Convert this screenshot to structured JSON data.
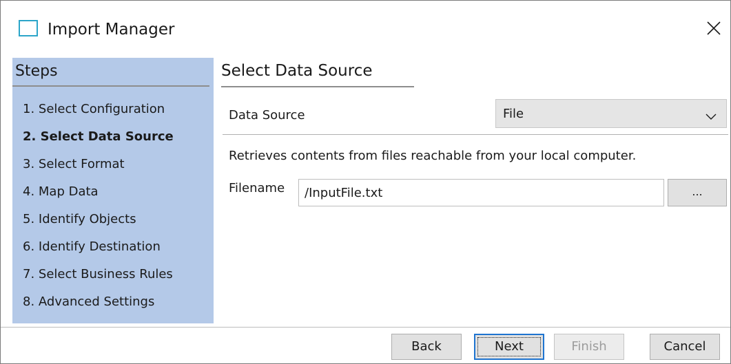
{
  "window": {
    "title": "Import Manager",
    "close_icon": "close-x-icon",
    "app_icon": "window-icon"
  },
  "steps": {
    "title": "Steps",
    "items": [
      "1. Select Configuration",
      "2. Select Data Source",
      "3. Select Format",
      "4. Map Data",
      "5. Identify Objects",
      "6. Identify Destination",
      "7. Select Business Rules",
      "8. Advanced Settings"
    ],
    "current_index": 1
  },
  "main": {
    "title": "Select Data Source",
    "data_source_label": "Data Source",
    "data_source_value": "File",
    "description": "Retrieves contents from files reachable from your local computer.",
    "filename_label": "Filename",
    "filename_value": "/InputFile.txt",
    "browse_label": "..."
  },
  "buttons": {
    "back": "Back",
    "next": "Next",
    "finish": "Finish",
    "cancel": "Cancel"
  },
  "colors": {
    "steps_panel": "#b4c9e8",
    "app_icon": "#2ba5c9",
    "default_button_border": "#1e74d0"
  }
}
